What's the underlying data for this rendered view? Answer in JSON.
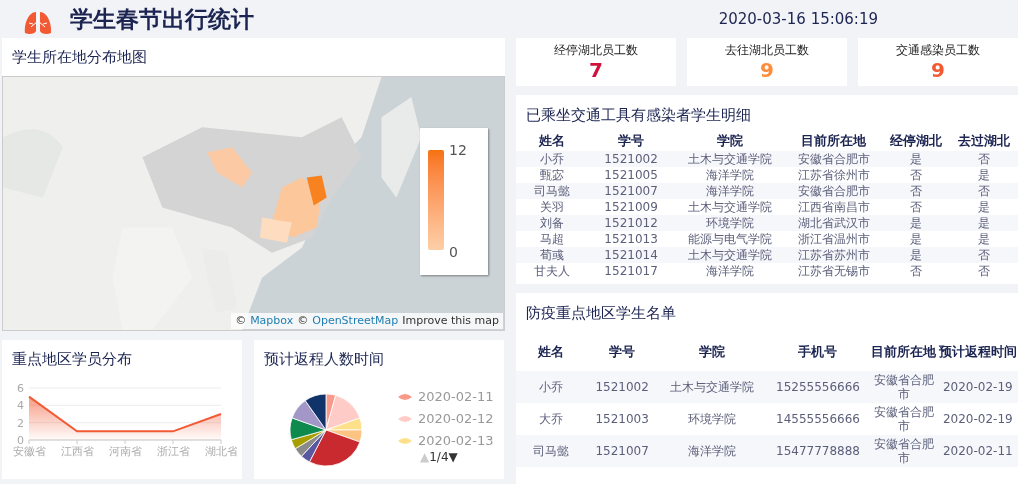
{
  "header": {
    "title": "学生春节出行统计",
    "datetime": "2020-03-16 15:06:19"
  },
  "map_card": {
    "title": "学生所在地分布地图",
    "legend": {
      "max": "12",
      "min": "0"
    },
    "attribution": {
      "prefix": "©",
      "mapbox": "Mapbox",
      "sep": "©",
      "osm": "OpenStreetMap",
      "improve": "Improve this map"
    }
  },
  "stats": [
    {
      "label": "经停湖北员工数",
      "value": "7",
      "color": "#d0113c"
    },
    {
      "label": "去往湖北员工数",
      "value": "9",
      "color": "#ff8c3a"
    },
    {
      "label": "交通感染员工数",
      "value": "9",
      "color": "#f25a34"
    }
  ],
  "infected_table": {
    "title": "已乘坐交通工具有感染者学生明细",
    "columns": [
      "姓名",
      "学号",
      "学院",
      "目前所在地",
      "经停湖北",
      "去过湖北"
    ],
    "rows": [
      [
        "小乔",
        "1521002",
        "土木与交通学院",
        "安徽省合肥市",
        "是",
        "否"
      ],
      [
        "甄宓",
        "1521005",
        "海洋学院",
        "江苏省徐州市",
        "否",
        "是"
      ],
      [
        "司马懿",
        "1521007",
        "海洋学院",
        "安徽省合肥市",
        "否",
        "否"
      ],
      [
        "关羽",
        "1521009",
        "土木与交通学院",
        "江西省南昌市",
        "否",
        "是"
      ],
      [
        "刘备",
        "1521012",
        "环境学院",
        "湖北省武汉市",
        "是",
        "是"
      ],
      [
        "马超",
        "1521013",
        "能源与电气学院",
        "浙江省温州市",
        "是",
        "是"
      ],
      [
        "荀彧",
        "1521014",
        "土木与交通学院",
        "江苏省苏州市",
        "是",
        "否"
      ],
      [
        "甘夫人",
        "1521017",
        "海洋学院",
        "江苏省无锡市",
        "否",
        "否"
      ]
    ]
  },
  "key_area_table": {
    "title": "防疫重点地区学生名单",
    "columns": [
      "姓名",
      "学号",
      "学院",
      "手机号",
      "目前所在地",
      "预计返程时间"
    ],
    "rows": [
      [
        "小乔",
        "1521002",
        "土木与交通学院",
        "15255556666",
        "安徽省合肥市",
        "2020-02-19"
      ],
      [
        "大乔",
        "1521003",
        "环境学院",
        "14555556666",
        "安徽省合肥市",
        "2020-02-19"
      ],
      [
        "司马懿",
        "1521007",
        "海洋学院",
        "15477778888",
        "安徽省合肥市",
        "2020-02-11"
      ]
    ]
  },
  "region_chart": {
    "title": "重点地区学员分布",
    "chart_data": {
      "type": "area",
      "categories": [
        "安徽省",
        "江西省",
        "河南省",
        "浙江省",
        "湖北省"
      ],
      "series": [
        {
          "color": "#f25a34",
          "values": [
            5,
            1,
            1,
            1,
            3
          ]
        }
      ],
      "ylim": [
        0,
        6
      ],
      "yticks": [
        0,
        2,
        4,
        6
      ]
    }
  },
  "return_chart": {
    "title": "预计返程人数时间",
    "legend": [
      {
        "label": "2020-02-11",
        "color": "#f9998a"
      },
      {
        "label": "2020-02-12",
        "color": "#ffcbc6"
      },
      {
        "label": "2020-02-13",
        "color": "#ffe08a"
      }
    ],
    "pager": {
      "prev": "▲",
      "page": "1/4",
      "next": "▼",
      "prev_disabled": true
    }
  }
}
